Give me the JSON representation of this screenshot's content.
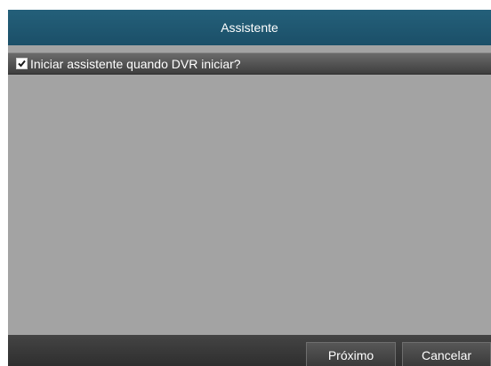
{
  "dialog": {
    "title": "Assistente",
    "option": {
      "label": "Iniciar assistente quando DVR iniciar?",
      "checked": true
    },
    "buttons": {
      "next_label": "Próximo",
      "cancel_label": "Cancelar"
    }
  }
}
